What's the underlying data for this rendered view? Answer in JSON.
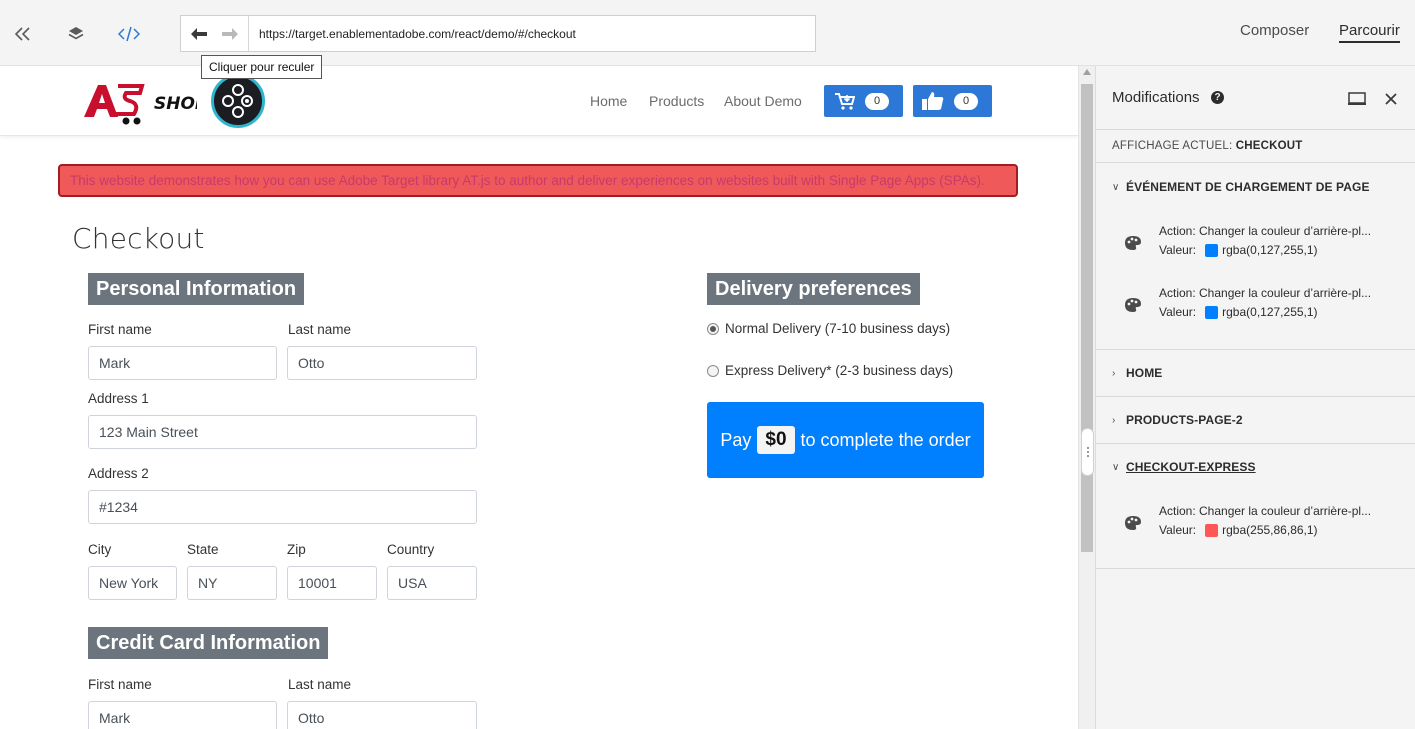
{
  "toolbar": {
    "url": "https://target.enablementadobe.com/react/demo/#/checkout",
    "back_tooltip": "Cliquer pour reculer",
    "mode_compose": "Composer",
    "mode_browse": "Parcourir"
  },
  "site": {
    "logo_text": "SHOP",
    "nav": [
      "Home",
      "Products",
      "About Demo"
    ],
    "cart_count": "0",
    "like_count": "0",
    "banner": "This website demonstrates how you can use Adobe Target library AT.js to author and deliver experiences on websites built with Single Page Apps (SPAs).",
    "page_title": "Checkout",
    "personal": {
      "title": "Personal Information",
      "first_name_label": "First name",
      "first_name": "Mark",
      "last_name_label": "Last name",
      "last_name": "Otto",
      "address1_label": "Address 1",
      "address1": "123 Main Street",
      "address2_label": "Address 2",
      "address2": "#1234",
      "city_label": "City",
      "city": "New York",
      "state_label": "State",
      "state": "NY",
      "zip_label": "Zip",
      "zip": "10001",
      "country_label": "Country",
      "country": "USA"
    },
    "credit": {
      "title": "Credit Card Information",
      "first_name_label": "First name",
      "first_name": "Mark",
      "last_name_label": "Last name",
      "last_name": "Otto"
    },
    "delivery": {
      "title": "Delivery preferences",
      "normal": "Normal Delivery (7-10 business days)",
      "express": "Express Delivery* (2-3 business days)"
    },
    "pay": {
      "prefix": "Pay",
      "amount": "$0",
      "suffix": "to complete the order"
    }
  },
  "panel": {
    "title": "Modifications",
    "current_view_label": "AFFICHAGE ACTUEL:",
    "current_view_value": "CHECKOUT",
    "groups": {
      "page_load": "ÉVÉNEMENT DE CHARGEMENT DE PAGE",
      "home": "HOME",
      "products": "PRODUCTS-PAGE-2",
      "checkout_express": "CHECKOUT-EXPRESS"
    },
    "value_label": "Valeur:",
    "actions": [
      {
        "text": "Action: Changer la couleur d’arrière-pl...",
        "value": "rgba(0,127,255,1)",
        "color": "#007fff"
      },
      {
        "text": "Action: Changer la couleur d’arrière-pl...",
        "value": "rgba(0,127,255,1)",
        "color": "#007fff"
      },
      {
        "text": "Action: Changer la couleur d’arrière-pl...",
        "value": "rgba(255,86,86,1)",
        "color": "#ff5656"
      }
    ]
  },
  "colors": {
    "accent_blue": "#2d78d6",
    "pay_blue": "#007fff",
    "banner_red": "#f0595a",
    "section_gray": "#6c757d"
  }
}
